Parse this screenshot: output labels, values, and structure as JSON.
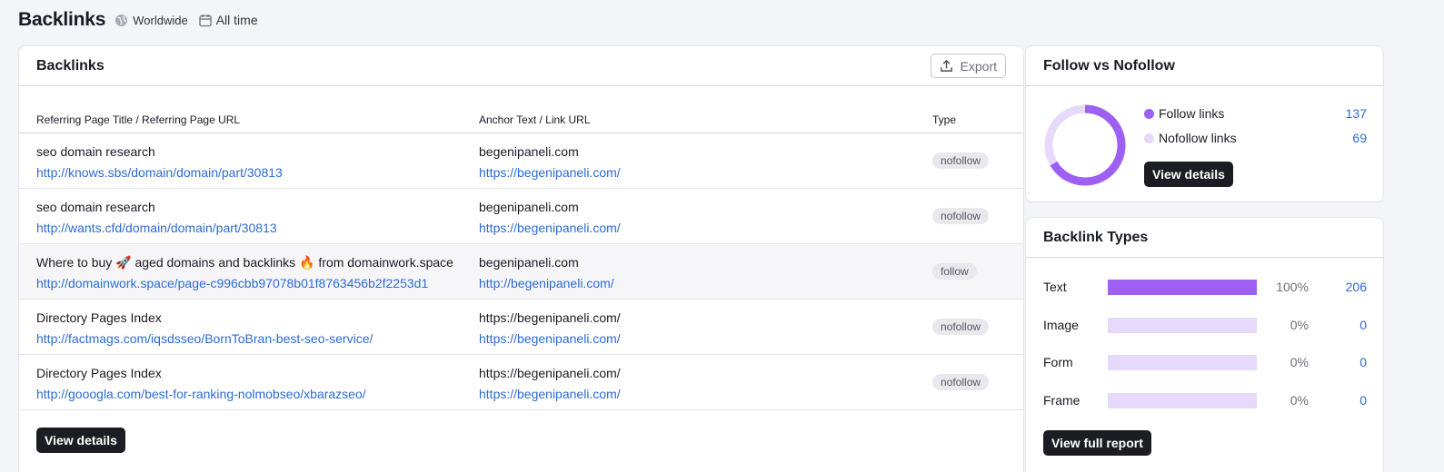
{
  "header": {
    "title": "Backlinks",
    "region": "Worldwide",
    "period": "All time"
  },
  "backlinks": {
    "title": "Backlinks",
    "export_label": "Export",
    "columns": [
      "Referring Page Title / Referring Page URL",
      "Anchor Text / Link URL",
      "Type"
    ],
    "rows": [
      {
        "title": "seo domain research",
        "url": "http://knows.sbs/domain/domain/part/30813",
        "anchor": "begenipaneli.com",
        "link": "https://begenipaneli.com/",
        "type": "nofollow"
      },
      {
        "title": "seo domain research",
        "url": "http://wants.cfd/domain/domain/part/30813",
        "anchor": "begenipaneli.com",
        "link": "https://begenipaneli.com/",
        "type": "nofollow"
      },
      {
        "title": "Where to buy 🚀 aged domains and backlinks 🔥 from domainwork.space",
        "url": "http://domainwork.space/page-c996cbb97078b01f8763456b2f2253d1",
        "anchor": "begenipaneli.com",
        "link": "http://begenipaneli.com/",
        "type": "follow"
      },
      {
        "title": "Directory Pages Index",
        "url": "http://factmags.com/iqsdsseo/BornToBran-best-seo-service/",
        "anchor": "https://begenipaneli.com/",
        "link": "https://begenipaneli.com/",
        "type": "nofollow"
      },
      {
        "title": "Directory Pages Index",
        "url": "http://gooogla.com/best-for-ranking-nolmobseo/xbarazseo/",
        "anchor": "https://begenipaneli.com/",
        "link": "https://begenipaneli.com/",
        "type": "nofollow"
      }
    ],
    "view_details_label": "View details"
  },
  "follow": {
    "title": "Follow vs Nofollow",
    "items": [
      {
        "label": "Follow links",
        "value": "137",
        "color": "#9e5ff3"
      },
      {
        "label": "Nofollow links",
        "value": "69",
        "color": "#e6d9fb"
      }
    ],
    "view_details_label": "View details"
  },
  "types": {
    "title": "Backlink Types",
    "rows": [
      {
        "label": "Text",
        "pct": "100%",
        "fraction": 1.0,
        "count": "206"
      },
      {
        "label": "Image",
        "pct": "0%",
        "fraction": 0,
        "count": "0"
      },
      {
        "label": "Form",
        "pct": "0%",
        "fraction": 0,
        "count": "0"
      },
      {
        "label": "Frame",
        "pct": "0%",
        "fraction": 0,
        "count": "0"
      }
    ],
    "view_report_label": "View full report"
  },
  "colors": {
    "accent": "#9e5ff3",
    "accent_light": "#e6d9fb",
    "link": "#2c6bd6",
    "dark_button": "#1c1d22"
  }
}
